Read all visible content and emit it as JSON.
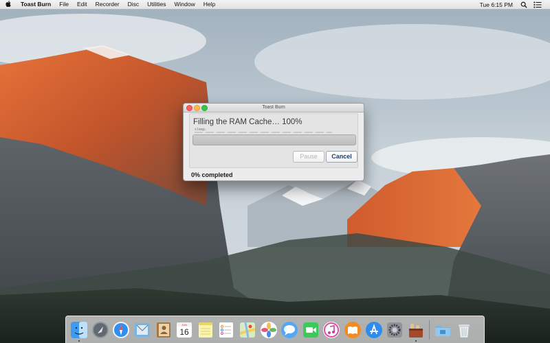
{
  "menubar": {
    "apple_icon": "apple-logo-icon",
    "app_name": "Toast Burn",
    "menus": [
      "File",
      "Edit",
      "Recorder",
      "Disc",
      "Utilities",
      "Window",
      "Help"
    ],
    "clock": "Tue 6:15 PM",
    "right_icons": [
      "search-icon",
      "notification-center-icon"
    ]
  },
  "window": {
    "title": "Toast Burn",
    "heading": "Filling the RAM Cache… 100%",
    "log_text": "sleep.",
    "progress_percent": 0,
    "pause_label": "Pause",
    "cancel_label": "Cancel",
    "status": "0% completed"
  },
  "dock": {
    "apps": [
      "finder-icon",
      "launchpad-icon",
      "safari-icon",
      "mail-icon",
      "contacts-icon",
      "calendar-icon",
      "notes-icon",
      "reminders-icon",
      "maps-icon",
      "photos-icon",
      "messages-icon",
      "facetime-icon",
      "itunes-icon",
      "ibooks-icon",
      "app-store-icon",
      "system-preferences-icon",
      "toast-icon"
    ],
    "calendar_month": "JUN",
    "calendar_day": "16",
    "trailing": [
      "downloads-folder-icon",
      "trash-icon"
    ]
  },
  "colors": {
    "menubar_bg": "#eaeaea",
    "window_bg": "#ececec",
    "close": "#fc605b",
    "minimize": "#fdbc40",
    "maximize": "#34c84a",
    "cancel_text": "#1f3d66"
  }
}
